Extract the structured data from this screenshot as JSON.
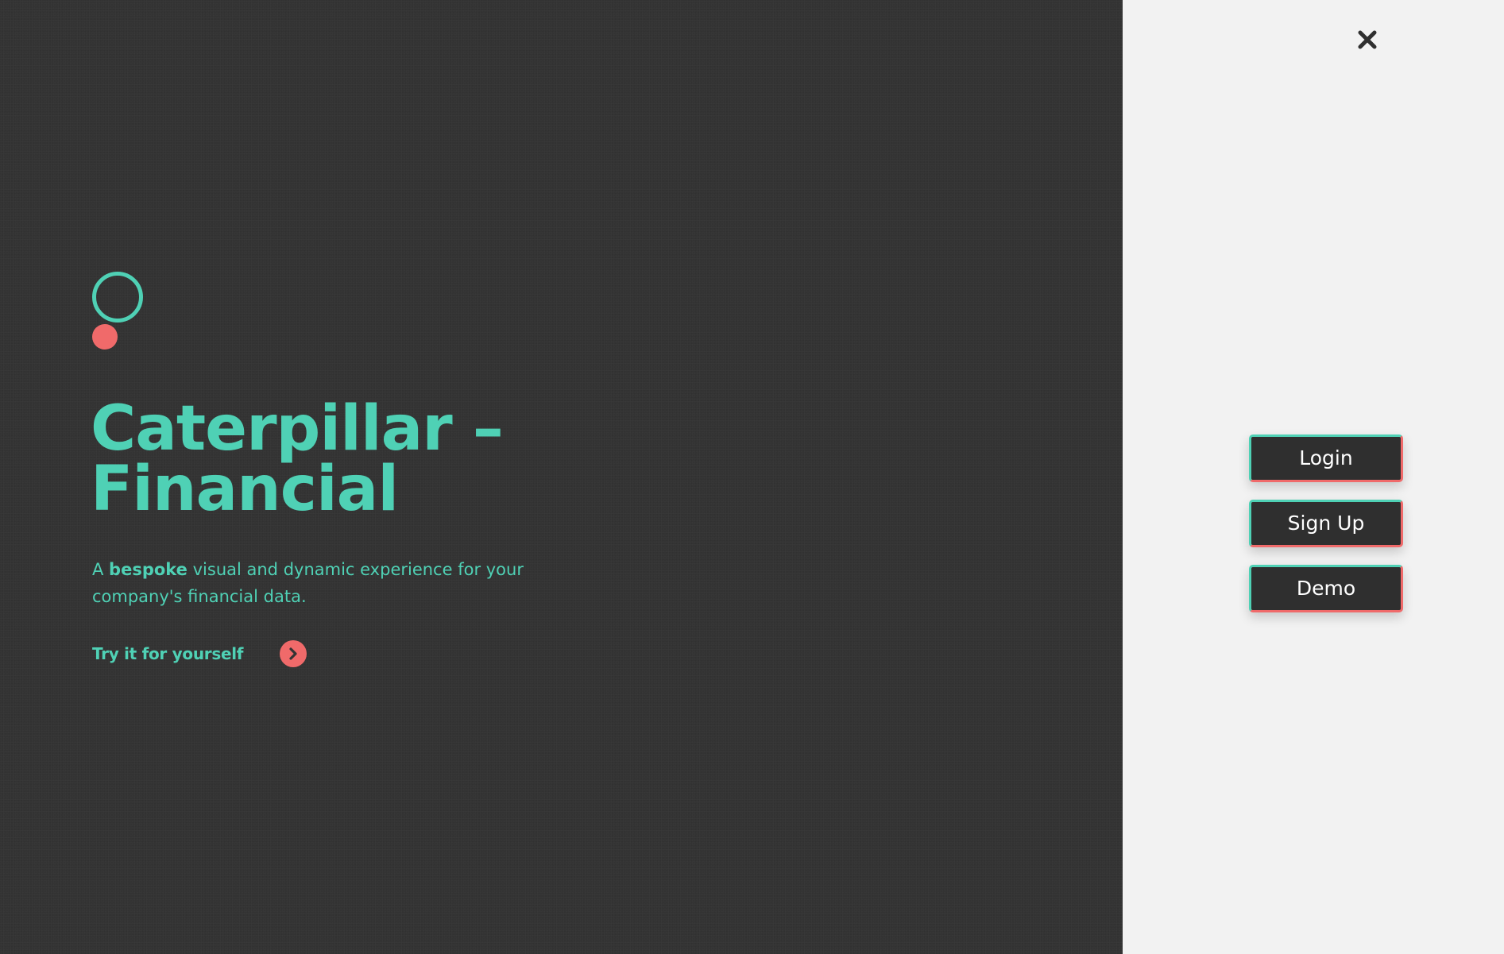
{
  "hero": {
    "title_line1": "Caterpillar –",
    "title_line2": "Financial",
    "subtitle_prefix": "A ",
    "subtitle_bold": "bespoke",
    "subtitle_suffix": " visual and dynamic experience for your company's financial data.",
    "cta_label": "Try it for yourself",
    "cta_icon": "chevron-right-circle-icon"
  },
  "logo": {
    "ring_icon": "ring-icon",
    "dot_icon": "dot-icon"
  },
  "panel": {
    "close_icon": "close-icon",
    "buttons": [
      {
        "label": "Login"
      },
      {
        "label": "Sign Up"
      },
      {
        "label": "Demo"
      }
    ]
  },
  "colors": {
    "hero_background": "#333333",
    "panel_background": "#f2f2f2",
    "accent_teal": "#4fd1b5",
    "accent_coral": "#f06a6a",
    "button_background": "#2f2f2f",
    "button_text": "#ffffff"
  }
}
